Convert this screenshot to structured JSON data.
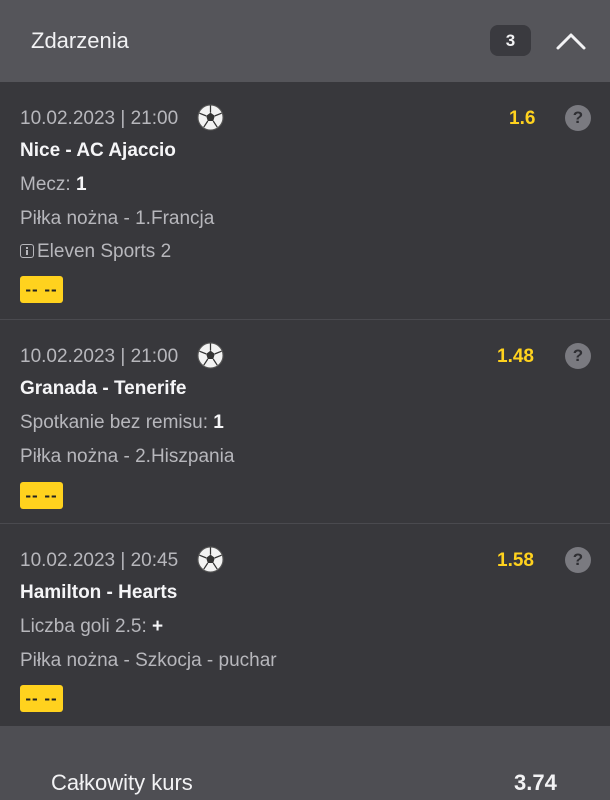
{
  "header": {
    "title": "Zdarzenia",
    "count": "3"
  },
  "events": [
    {
      "datetime": "10.02.2023 | 21:00",
      "odds": "1.6",
      "teams": "Nice - AC Ajaccio",
      "market_label": "Mecz: ",
      "market_pick": "1",
      "league": "Piłka nożna - 1.Francja",
      "broadcast": "Eleven Sports 2",
      "status": "-- --",
      "help": "?"
    },
    {
      "datetime": "10.02.2023 | 21:00",
      "odds": "1.48",
      "teams": "Granada - Tenerife",
      "market_label": "Spotkanie bez remisu: ",
      "market_pick": "1",
      "league": "Piłka nożna - 2.Hiszpania",
      "status": "-- --",
      "help": "?"
    },
    {
      "datetime": "10.02.2023 | 20:45",
      "odds": "1.58",
      "teams": "Hamilton - Hearts",
      "market_label": "Liczba goli 2.5: ",
      "market_pick": "+",
      "league": "Piłka nożna - Szkocja - puchar",
      "status": "-- --",
      "help": "?"
    }
  ],
  "footer": {
    "total_label": "Całkowity kurs",
    "total_value": "3.74"
  },
  "colors": {
    "accent": "#ffd21e",
    "header_bg": "#55555a",
    "card_bg": "#38383c"
  }
}
